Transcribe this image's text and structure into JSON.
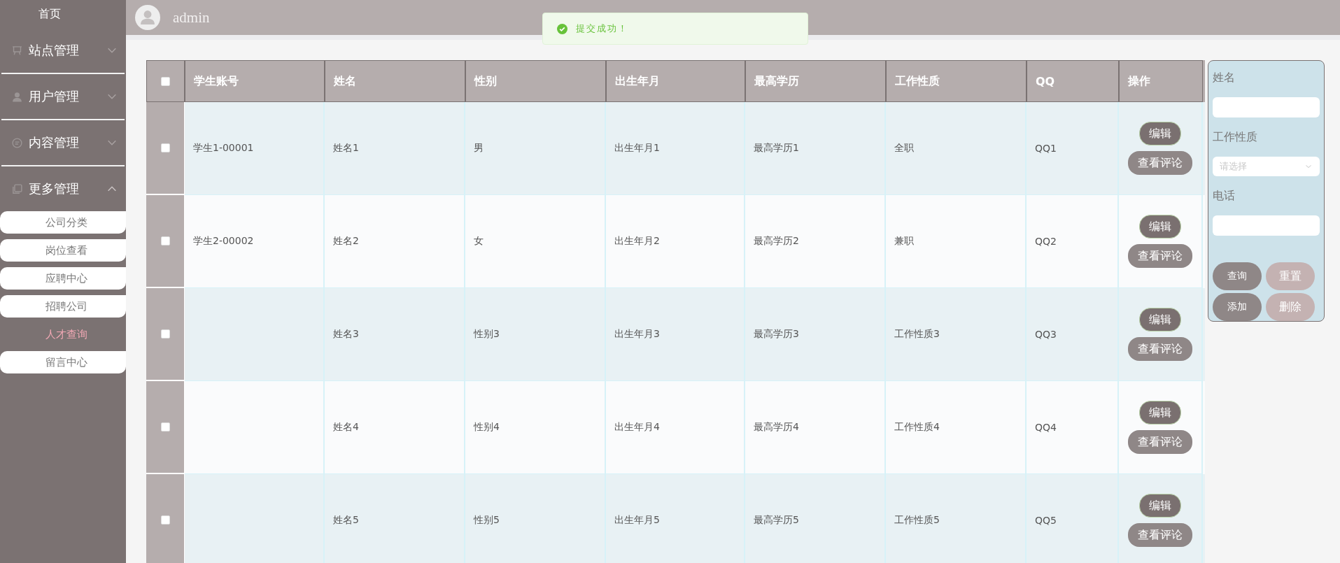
{
  "sidebar": {
    "home": "首页",
    "groups": [
      {
        "label": "站点管理",
        "expanded": false
      },
      {
        "label": "用户管理",
        "expanded": false
      },
      {
        "label": "内容管理",
        "expanded": false
      },
      {
        "label": "更多管理",
        "expanded": true,
        "children": [
          {
            "label": "公司分类",
            "selected": false
          },
          {
            "label": "岗位查看",
            "selected": false
          },
          {
            "label": "应聘中心",
            "selected": false
          },
          {
            "label": "招聘公司",
            "selected": false
          },
          {
            "label": "人才查询",
            "selected": true
          },
          {
            "label": "留言中心",
            "selected": false
          }
        ]
      }
    ]
  },
  "header": {
    "user": "admin"
  },
  "toast": {
    "message": "提交成功！"
  },
  "table": {
    "select_all": {
      "checked": false
    },
    "columns": [
      "学生账号",
      "姓名",
      "性别",
      "出生年月",
      "最高学历",
      "工作性质",
      "QQ",
      "操作"
    ],
    "rows": [
      {
        "checked": false,
        "cells": [
          "学生1-00001",
          "姓名1",
          "男",
          "出生年月1",
          "最高学历1",
          "全职",
          "QQ1"
        ],
        "actions": [
          "编辑",
          "查看评论"
        ]
      },
      {
        "checked": false,
        "cells": [
          "学生2-00002",
          "姓名2",
          "女",
          "出生年月2",
          "最高学历2",
          "兼职",
          "QQ2"
        ],
        "actions": [
          "编辑",
          "查看评论"
        ]
      },
      {
        "checked": false,
        "cells": [
          "",
          "姓名3",
          "性别3",
          "出生年月3",
          "最高学历3",
          "工作性质3",
          "QQ3"
        ],
        "actions": [
          "编辑",
          "查看评论"
        ]
      },
      {
        "checked": false,
        "cells": [
          "",
          "姓名4",
          "性别4",
          "出生年月4",
          "最高学历4",
          "工作性质4",
          "QQ4"
        ],
        "actions": [
          "编辑",
          "查看评论"
        ]
      },
      {
        "checked": false,
        "cells": [
          "",
          "姓名5",
          "性别5",
          "出生年月5",
          "最高学历5",
          "工作性质5",
          "QQ5"
        ],
        "actions": [
          "编辑",
          "查看评论"
        ]
      }
    ]
  },
  "search_panel": {
    "fields": [
      {
        "label": "姓名",
        "kind": "text"
      },
      {
        "label": "工作性质",
        "kind": "select",
        "placeholder": "请选择"
      },
      {
        "label": "电话",
        "kind": "text"
      }
    ],
    "buttons": [
      {
        "label": "查询",
        "disabled": false
      },
      {
        "label": "重置",
        "disabled": true
      },
      {
        "label": "添加",
        "disabled": false
      },
      {
        "label": "删除",
        "disabled": true
      }
    ]
  }
}
